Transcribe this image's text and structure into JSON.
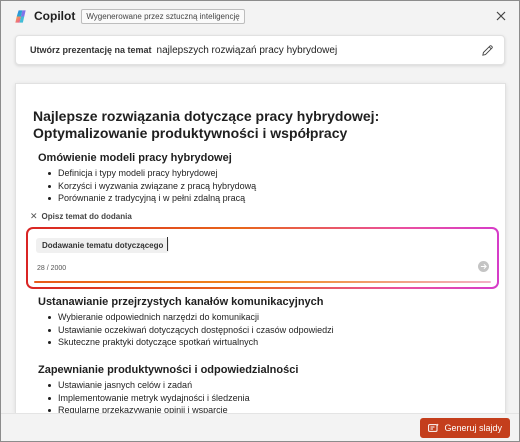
{
  "app": {
    "title": "Copilot",
    "ai_badge": "Wygenerowane przez sztuczną inteligencję",
    "close_icon": "close-icon"
  },
  "topic": {
    "label": "Utwórz prezentację na temat",
    "text": "najlepszych rozwiązań pracy hybrydowej",
    "edit_icon": "pencil-icon"
  },
  "document": {
    "title": "Najlepsze rozwiązania dotyczące pracy hybrydowej: Optymalizowanie produktywności i współpracy",
    "sections": [
      {
        "heading": "Omówienie modeli pracy hybrydowej",
        "bullets": [
          "Definicja i typy modeli pracy hybrydowej",
          "Korzyści i wyzwania związane z pracą hybrydową",
          "Porównanie z tradycyjną i w pełni zdalną pracą"
        ]
      },
      {
        "heading": "Ustanawianie przejrzystych kanałów komunikacyjnych",
        "bullets": [
          "Wybieranie odpowiednich narzędzi do komunikacji",
          "Ustawianie oczekiwań dotyczących dostępności i czasów odpowiedzi",
          "Skuteczne praktyki dotyczące spotkań wirtualnych"
        ]
      },
      {
        "heading": "Zapewnianie produktywności i odpowiedzialności",
        "bullets": [
          "Ustawianie jasnych celów i zadań",
          "Implementowanie metryk wydajności i śledzenia",
          "Regularne przekazywanie opinii i wsparcie"
        ]
      }
    ],
    "add_topic": {
      "label": "Opisz temat do dodania",
      "chip": "Dodawanie tematu dotyczącego",
      "char_count": "28 / 2000"
    }
  },
  "footer": {
    "generate_label": "Generuj slajdy"
  },
  "colors": {
    "accent": "#c43e1c",
    "gradient_start": "#d92424",
    "gradient_end": "#d63cc9"
  }
}
